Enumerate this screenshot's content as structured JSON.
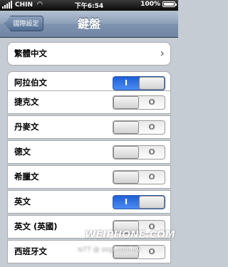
{
  "status_bar": {
    "carrier": "CHIN",
    "time": "下午6:54",
    "battery": "100%",
    "battery_level": 1.0
  },
  "nav": {
    "back_label": "國際設定",
    "title": "鍵盤"
  },
  "rows": [
    {
      "label": "繁體中文",
      "type": "disclosure",
      "icon": "chevron-right-icon",
      "glyph": "›"
    },
    {
      "label": "阿拉伯文",
      "type": "toggle",
      "on": true,
      "glyph": "I"
    },
    {
      "label": "捷克文",
      "type": "toggle",
      "on": false,
      "glyph": "O"
    },
    {
      "label": "丹麥文",
      "type": "toggle",
      "on": false,
      "glyph": "O"
    },
    {
      "label": "德文",
      "type": "toggle",
      "on": false,
      "glyph": "O"
    },
    {
      "label": "希臘文",
      "type": "toggle",
      "on": false,
      "glyph": "O"
    },
    {
      "label": "英文",
      "type": "toggle",
      "on": true,
      "glyph": "I"
    },
    {
      "label": "英文 (英國)",
      "type": "toggle",
      "on": false,
      "glyph": "O"
    },
    {
      "label": "西班牙文",
      "type": "toggle",
      "on": false,
      "glyph": "O"
    }
  ],
  "watermark": {
    "logo": "WEIPHONE.COM",
    "site": "w77 @ sogi.com.tw"
  },
  "colors": {
    "toggle_on": "#2f74e8",
    "nav_bar": "#8ca0b9",
    "background": "#c5ccd4"
  }
}
